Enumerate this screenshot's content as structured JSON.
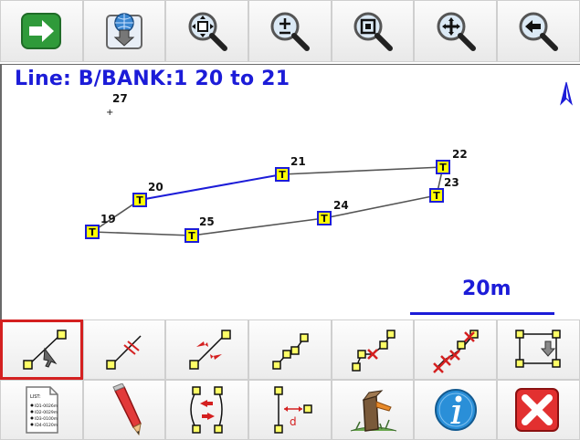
{
  "toolbar": {
    "buttons": [
      {
        "name": "forward-arrow-icon"
      },
      {
        "name": "globe-download-icon"
      },
      {
        "name": "zoom-fit-icon"
      },
      {
        "name": "zoom-plus-minus-icon"
      },
      {
        "name": "zoom-window-icon"
      },
      {
        "name": "zoom-pan-icon"
      },
      {
        "name": "zoom-back-icon"
      }
    ]
  },
  "map": {
    "line_title": "Line: B/BANK:1  20 to 21",
    "north_icon": "north-arrow-icon",
    "stray_label": "27",
    "stations": [
      "19",
      "20",
      "21",
      "22",
      "23",
      "24",
      "25"
    ],
    "station_marker_text": "T",
    "scale_label": "20m",
    "colors": {
      "selected_line": "#1c1cd8",
      "other_line": "#555555",
      "marker_fill": "#ffff00"
    }
  },
  "tools": {
    "row1": [
      {
        "name": "select-line-icon",
        "selected": true
      },
      {
        "name": "split-line-icon"
      },
      {
        "name": "reverse-line-icon"
      },
      {
        "name": "polyline-icon"
      },
      {
        "name": "delete-point-icon"
      },
      {
        "name": "delete-points-icon"
      },
      {
        "name": "rectangle-down-icon"
      }
    ],
    "row2": [
      {
        "name": "list-document-icon",
        "doc_title": "LIST:",
        "doc_rows": [
          "ID1-0026m",
          "ID2-0029m",
          "ID3-0100m",
          "ID4-0120m"
        ]
      },
      {
        "name": "pencil-icon"
      },
      {
        "name": "swap-lines-icon"
      },
      {
        "name": "distance-icon",
        "label": "d"
      },
      {
        "name": "survey-stake-icon"
      },
      {
        "name": "info-icon"
      },
      {
        "name": "close-icon"
      }
    ]
  }
}
